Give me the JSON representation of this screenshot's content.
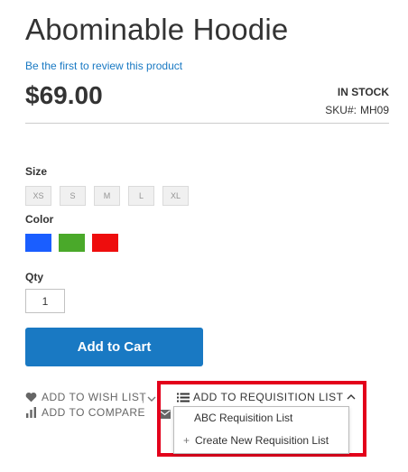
{
  "product": {
    "name": "Abominable Hoodie",
    "review_link": "Be the first to review this product",
    "price": "$69.00",
    "stock": "IN STOCK",
    "sku_label": "SKU#:",
    "sku_value": "MH09"
  },
  "options": {
    "size_label": "Size",
    "sizes": [
      "XS",
      "S",
      "M",
      "L",
      "XL"
    ],
    "color_label": "Color",
    "colors": [
      "#1a5eff",
      "#4aa92a",
      "#ee0d0d"
    ],
    "qty_label": "Qty",
    "qty_value": "1"
  },
  "actions": {
    "add_to_cart": "Add to Cart",
    "wish_list": "ADD TO WISH LIST",
    "separator": "|",
    "compare": "ADD TO COMPARE",
    "requisition_toggle": "ADD TO REQUISITION LIST"
  },
  "requisition_dropdown": {
    "items": [
      "ABC Requisition List"
    ],
    "create_new": "Create New Requisition List",
    "create_icon": "+"
  },
  "colors": {
    "link": "#1979c3",
    "button": "#1979c3",
    "highlight": "#e3001b"
  },
  "icons": [
    "heart-icon",
    "bar-chart-icon",
    "chevron-down-icon",
    "envelope-icon",
    "list-icon",
    "chevron-up-icon",
    "plus-icon"
  ]
}
